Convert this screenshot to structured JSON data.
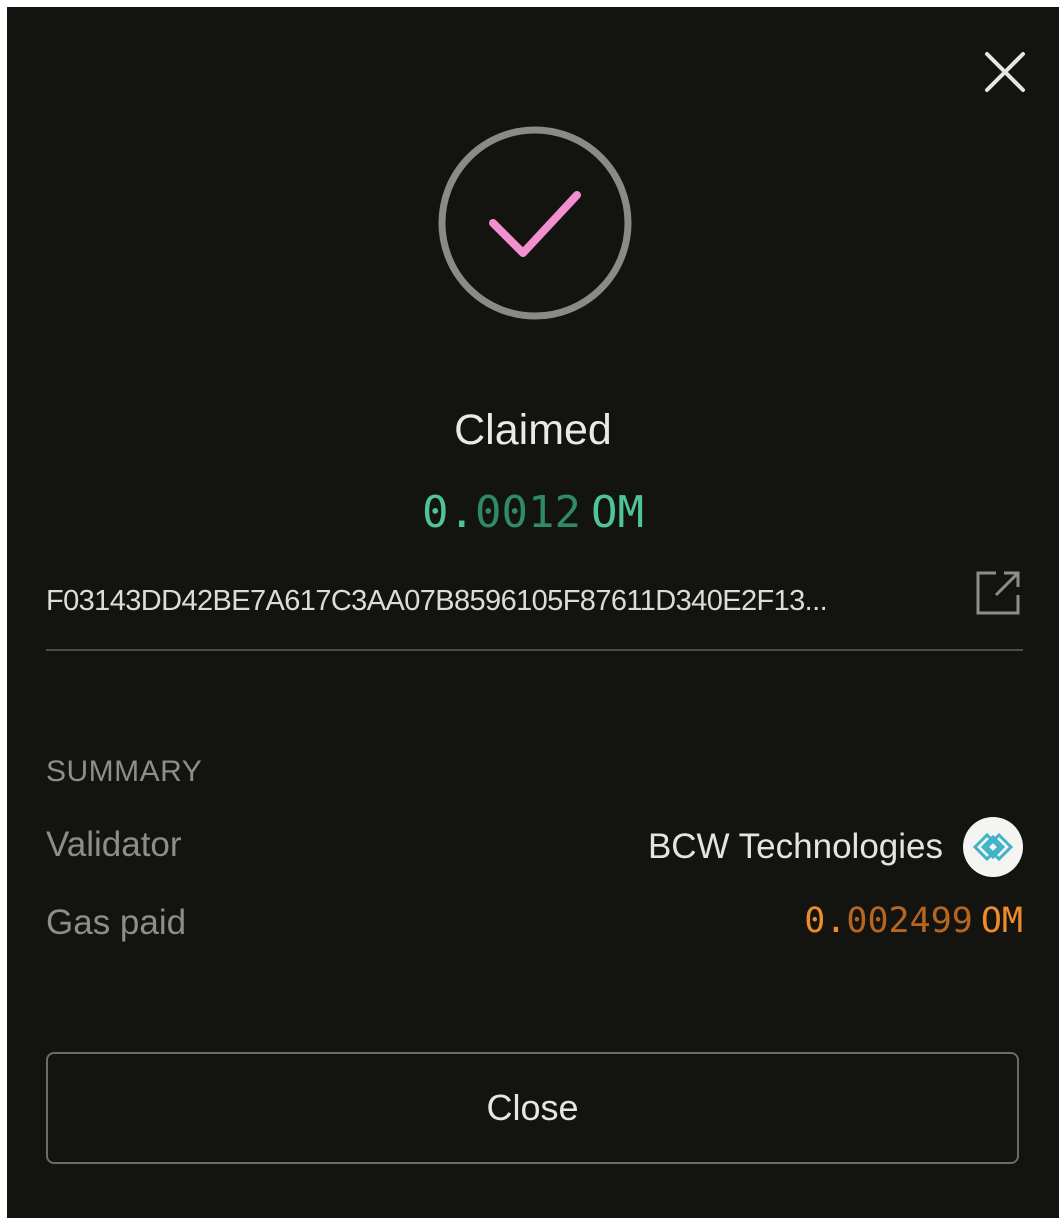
{
  "modal": {
    "close_icon": "close-icon",
    "status_icon": "checkmark-circle-icon",
    "title": "Claimed",
    "amount": {
      "lead": "0.",
      "rest": "0012",
      "unit": "OM"
    },
    "tx_hash": "F03143DD42BE7A617C3AA07B8596105F87611D340E2F13...",
    "external_link_icon": "external-link-icon",
    "summary": {
      "heading": "SUMMARY",
      "validator_label": "Validator",
      "validator_name": "BCW Technologies",
      "validator_logo_icon": "validator-logo-icon",
      "gas_label": "Gas paid",
      "gas_amount": {
        "lead": "0.",
        "rest": "002499",
        "unit": "OM"
      }
    },
    "close_button_label": "Close"
  },
  "colors": {
    "background": "#131310",
    "success_green": "#4fc39a",
    "check_pink": "#f28fd0",
    "gas_orange": "#f08b2c",
    "muted_text": "#8d8d89"
  }
}
